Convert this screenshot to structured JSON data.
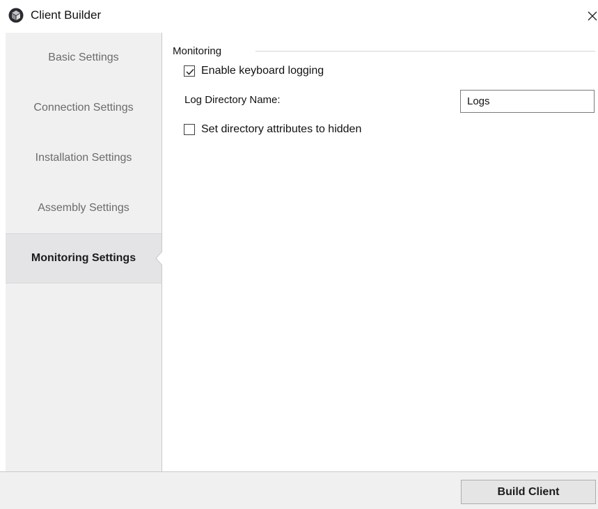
{
  "window": {
    "title": "Client Builder",
    "app_icon": "cube-logo-icon",
    "close_icon": "close-icon"
  },
  "sidebar": {
    "items": [
      {
        "label": "Basic Settings",
        "active": false
      },
      {
        "label": "Connection Settings",
        "active": false
      },
      {
        "label": "Installation Settings",
        "active": false
      },
      {
        "label": "Assembly Settings",
        "active": false
      },
      {
        "label": "Monitoring Settings",
        "active": true
      }
    ]
  },
  "monitoring": {
    "group_title": "Monitoring",
    "enable_keyboard_logging": {
      "label": "Enable keyboard logging",
      "checked": true
    },
    "log_directory": {
      "label": "Log Directory Name:",
      "value": "Logs"
    },
    "hidden_attributes": {
      "label": "Set directory attributes to hidden",
      "checked": false
    }
  },
  "footer": {
    "build_label": "Build Client"
  },
  "colors": {
    "sidebar_bg": "#f0f0f0",
    "active_item_bg": "#e4e4e7",
    "inactive_text": "#6b6b6b",
    "divider": "#c7c9cc"
  }
}
